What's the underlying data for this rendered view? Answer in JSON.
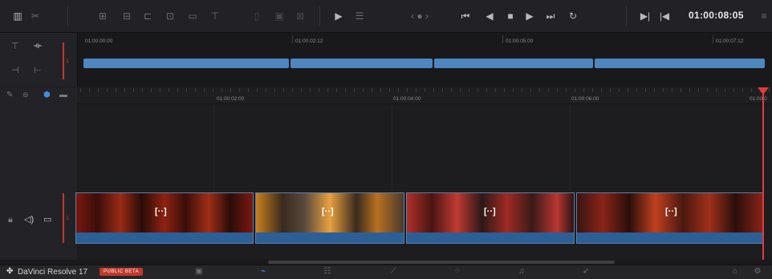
{
  "toolbar": {
    "timecode": "01:00:08:05",
    "transport_icons": [
      "prev-clip-icon",
      "reverse-play-icon",
      "stop-icon",
      "play-icon",
      "next-clip-icon",
      "loop-icon"
    ]
  },
  "upper_timeline": {
    "ruler_timecodes": [
      "01:00:00:00",
      "01:00:02:12",
      "01:00:05:00",
      "01:00:07:12"
    ],
    "track_number": "1"
  },
  "lower_timeline": {
    "ruler_timecodes": [
      "01:00:02:00",
      "01:00:04:00",
      "01:00:06:00",
      "01:00:0"
    ],
    "track_number": "1",
    "clip_marker": "[··]"
  },
  "footer": {
    "app_name": "DaVinci Resolve 17",
    "badge": "PUBLIC BETA",
    "pages": [
      "media-page-icon",
      "cut-page-icon",
      "edit-page-icon",
      "fusion-page-icon",
      "color-page-icon",
      "fairlight-page-icon",
      "deliver-page-icon"
    ],
    "active_page": "cut-page-icon"
  },
  "colors": {
    "accent": "#4e86c0",
    "playhead": "#e23b3b",
    "badge": "#c0392b"
  }
}
